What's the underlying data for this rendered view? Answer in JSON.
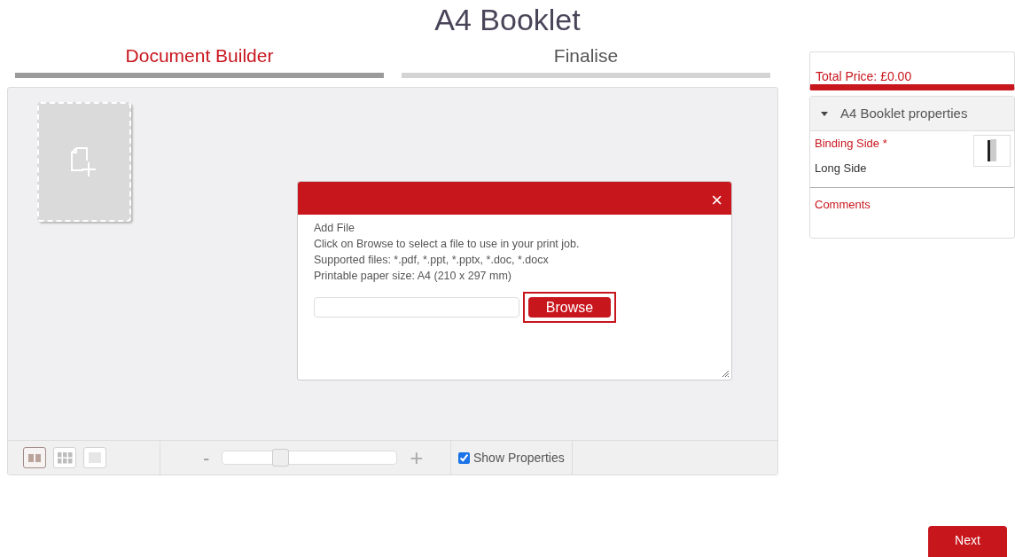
{
  "page_title": "A4 Booklet",
  "steps": [
    {
      "label": "Document Builder",
      "selected": true
    },
    {
      "label": "Finalise",
      "selected": false
    }
  ],
  "dialog": {
    "heading": "Add File",
    "lines": [
      "Click on Browse to select a file to use in your print job.",
      "Supported files: *.pdf, *.ppt, *.pptx, *.doc, *.docx",
      "Printable paper size: A4 (210 x 297 mm)"
    ],
    "close": "×",
    "browse": "Browse",
    "browse_highlighted": true
  },
  "toolbar": {
    "views": [
      {
        "kind": "spreads",
        "selected": true
      },
      {
        "kind": "grid",
        "selected": false
      },
      {
        "kind": "single",
        "selected": false
      }
    ],
    "zoom_out": "-",
    "zoom_in": "+",
    "zoom": {
      "level": 0.33
    },
    "show_properties": {
      "label": "Show Properties",
      "checked": true
    }
  },
  "sidebar": {
    "total_price": "Total Price: £0.00",
    "section": {
      "title": "A4 Booklet properties",
      "expanded": true
    },
    "binding_label": "Binding Side",
    "required_mark": "*",
    "binding_value": "Long Side",
    "comments_label": "Comments"
  },
  "next_button": "Next"
}
